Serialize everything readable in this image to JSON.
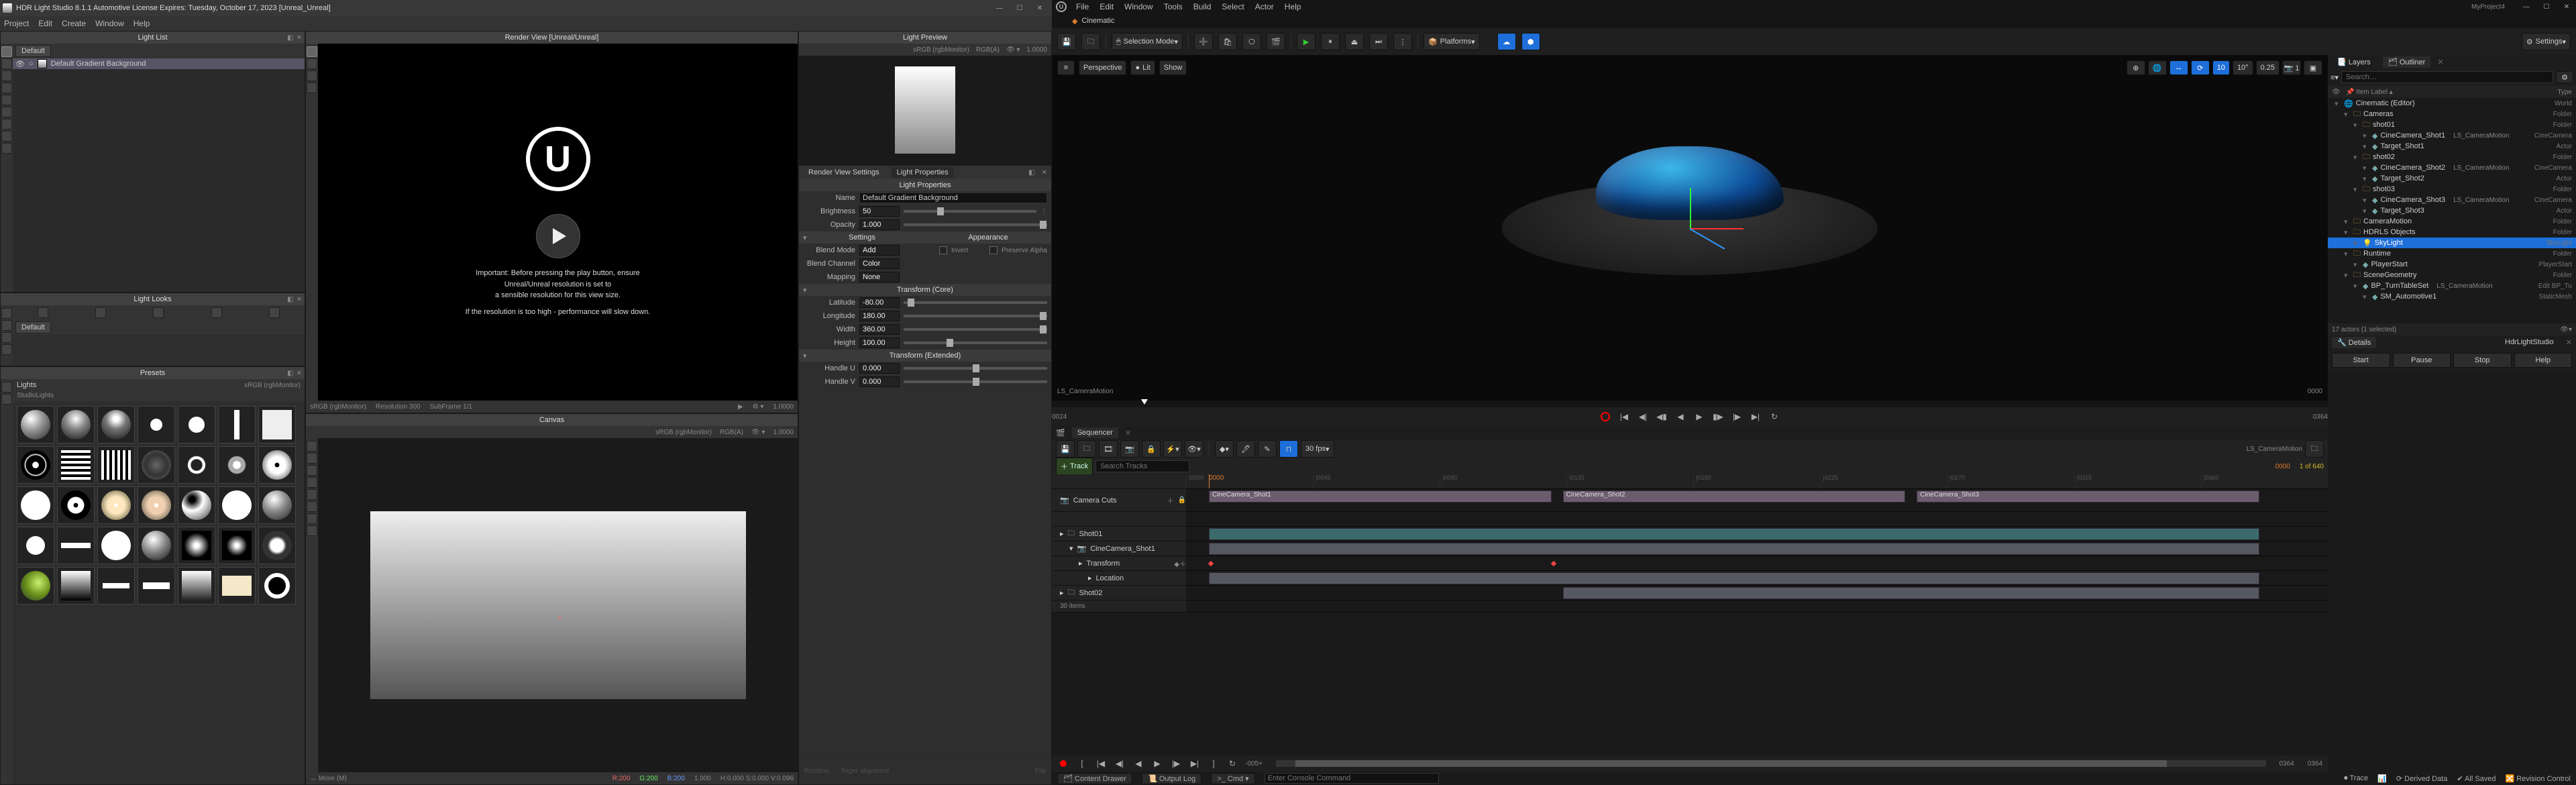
{
  "hdrls": {
    "title": "HDR Light Studio 8.1.1   Automotive License Expires: Tuesday, October 17, 2023   [Unreal_Unreal]",
    "menus": [
      "Project",
      "Edit",
      "Create",
      "Window",
      "Help"
    ],
    "lightList": {
      "title": "Light List",
      "defaultBtn": "Default",
      "item": "Default Gradient Background"
    },
    "lightLooks": {
      "title": "Light Looks",
      "defaultBtn": "Default"
    },
    "presets": {
      "title": "Presets",
      "tab_lights": "Lights",
      "tab_studio": "StudioLights",
      "color_space": "sRGB (rgbMonitor)"
    },
    "renderView": {
      "title": "Render View [Unreal/Unreal]",
      "msg1": "Important: Before pressing the play button, ensure",
      "msg2": "Unreal/Unreal resolution is set to",
      "msg3": "a sensible resolution for this view size.",
      "msg4": "If the resolution is too high - performance will slow down.",
      "bar_cs": "sRGB (rgbMonitor)",
      "bar_res": "Resolution 300",
      "bar_sub": "SubFrame 1/1",
      "bar_exp": "1.0000"
    },
    "canvas": {
      "title": "Canvas",
      "bar_cs": "sRGB (rgbMonitor)",
      "bar_ch": "RGB(A)",
      "bar_exp": "1.0000",
      "status_mode": "Move (M)",
      "status_rgb": "R:200  G:200  B:200",
      "status_val": "1.000",
      "status_hsv": "H:0.000 S:0.000 V:0.096"
    },
    "lightPreview": {
      "title": "Light Preview",
      "bar_cs": "sRGB (rgbMonitor)",
      "bar_ch": "RGB(A)",
      "bar_exp": "1.0000"
    },
    "renderSettingsTab": "Render View Settings",
    "lightPropsTab": "Light Properties",
    "props": {
      "title": "Light Properties",
      "name_lbl": "Name",
      "name_val": "Default Gradient Background",
      "brightness_lbl": "Brightness",
      "brightness_val": "50",
      "opacity_lbl": "Opacity",
      "opacity_val": "1.000",
      "settings_hdr": "Settings",
      "appearance_hdr": "Appearance",
      "blendmode_lbl": "Blend Mode",
      "blendmode_val": "Add",
      "invert_lbl": "Invert",
      "preserve_lbl": "Preserve Alpha",
      "blendch_lbl": "Blend Channel",
      "blendch_val": "Color",
      "mapping_lbl": "Mapping",
      "mapping_val": "None",
      "transform_core": "Transform (Core)",
      "lat_lbl": "Latitude",
      "lat_val": "-80.00",
      "lon_lbl": "Longitude",
      "lon_val": "180.00",
      "width_lbl": "Width",
      "width_val": "360.00",
      "height_lbl": "Height",
      "height_val": "100.00",
      "transform_ext": "Transform (Extended)",
      "hu_lbl": "Handle U",
      "hu_val": "0.000",
      "hv_lbl": "Handle V",
      "hv_val": "0.000"
    }
  },
  "ue": {
    "project": "MyProject4",
    "tab": "Cinematic",
    "menus": [
      "File",
      "Edit",
      "Window",
      "Tools",
      "Build",
      "Select",
      "Actor",
      "Help"
    ],
    "toolbar": {
      "save_icon": "save-icon",
      "mode": "Selection Mode",
      "platforms": "Platforms",
      "settings": "Settings"
    },
    "viewport": {
      "persp": "Perspective",
      "lit": "Lit",
      "show": "Show",
      "snap_a": "10",
      "snap_b": "10°",
      "snap_c": "0.25",
      "cam": "LS_CameraMotion",
      "frame_r": "0000"
    },
    "transport": {
      "frame_l": "0024",
      "frame_r": "0364"
    },
    "seq": {
      "tab": "Sequencer",
      "fps": "30 fps",
      "name": "LS_CameraMotion",
      "track_btn": "Track",
      "search_ph": "Search Tracks",
      "range_in": "0000",
      "range_out": "1 of 640",
      "in2": "0000",
      "out2": "0364",
      "camera_cuts": "Camera Cuts",
      "shot1": "Shot01",
      "cinecam1": "CineCamera_Shot1",
      "transform": "Transform",
      "location": "Location",
      "shot2": "Shot02",
      "items": "30 items",
      "clip1": "CineCamera_Shot1",
      "clip2": "CineCamera_Shot2",
      "clip3": "CineCamera_Shot3",
      "minus": "-005+",
      "plus": "0364"
    },
    "outliner": {
      "layers_tab": "Layers",
      "outliner_tab": "Outliner",
      "search_ph": "Search…",
      "col1": "Item Label",
      "col2": "Type",
      "rows": [
        {
          "ind": 0,
          "label": "Cinematic (Editor)",
          "type": "World"
        },
        {
          "ind": 1,
          "label": "Cameras",
          "type": "Folder"
        },
        {
          "ind": 2,
          "label": "shot01",
          "type": "Folder"
        },
        {
          "ind": 3,
          "label": "CineCamera_Shot1",
          "type": "CineCamera",
          "ext": "LS_CameraMotion"
        },
        {
          "ind": 3,
          "label": "Target_Shot1",
          "type": "Actor"
        },
        {
          "ind": 2,
          "label": "shot02",
          "type": "Folder"
        },
        {
          "ind": 3,
          "label": "CineCamera_Shot2",
          "type": "CineCamera",
          "ext": "LS_CameraMotion"
        },
        {
          "ind": 3,
          "label": "Target_Shot2",
          "type": "Actor"
        },
        {
          "ind": 2,
          "label": "shot03",
          "type": "Folder"
        },
        {
          "ind": 3,
          "label": "CineCamera_Shot3",
          "type": "CineCamera",
          "ext": "LS_CameraMotion"
        },
        {
          "ind": 3,
          "label": "Target_Shot3",
          "type": "Actor"
        },
        {
          "ind": 1,
          "label": "CameraMotion",
          "type": "Folder"
        },
        {
          "ind": 1,
          "label": "HDRLS Objects",
          "type": "Folder"
        },
        {
          "ind": 2,
          "label": "SkyLight",
          "type": "SkyLight",
          "sel": true
        },
        {
          "ind": 1,
          "label": "Runtime",
          "type": "Folder"
        },
        {
          "ind": 2,
          "label": "PlayerStart",
          "type": "PlayerStart"
        },
        {
          "ind": 1,
          "label": "SceneGeometry",
          "type": "Folder"
        },
        {
          "ind": 2,
          "label": "BP_TurnTableSet",
          "type": "Edit BP_Tu",
          "ext": "LS_CameraMotion"
        },
        {
          "ind": 3,
          "label": "SM_Automotive1",
          "type": "StaticMesh"
        }
      ],
      "footer": "17 actors (1 selected)"
    },
    "details": {
      "tab": "Details",
      "studio": "HdrLightStudio",
      "start": "Start",
      "pause": "Pause",
      "stop": "Stop",
      "help": "Help"
    },
    "status": {
      "content_drawer": "Content Drawer",
      "output_log": "Output Log",
      "cmd": "Cmd",
      "cmd_ph": "Enter Console Command",
      "trace": "Trace",
      "derived": "Derived Data",
      "saved": "All Saved",
      "rev": "Revision Control"
    }
  }
}
